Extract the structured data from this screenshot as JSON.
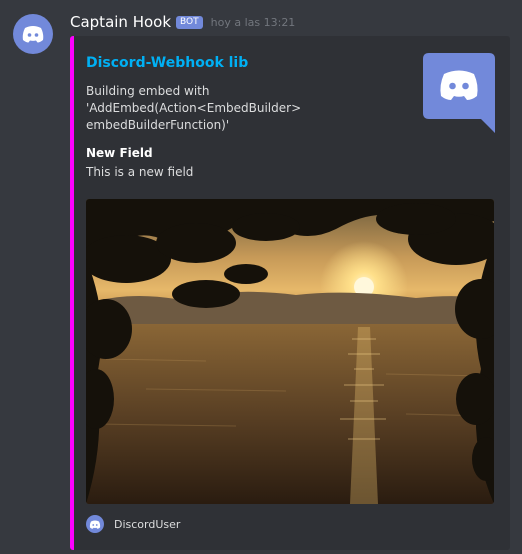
{
  "message": {
    "username": "Captain Hook",
    "bot_tag": "BOT",
    "timestamp": "hoy a las 13:21"
  },
  "embed": {
    "accent_color": "#ff00ff",
    "title": "Discord-Webhook lib",
    "description_line1": "Building embed with",
    "description_line2": "'AddEmbed(Action<EmbedBuilder>",
    "description_line3": "embedBuilderFunction)'",
    "field": {
      "name": "New Field",
      "value": "This is a new field"
    },
    "image_subject": "sunset over lake framed by tree branches",
    "thumbnail_icon": "discord-logo-icon",
    "footer_text": "DiscordUser"
  }
}
